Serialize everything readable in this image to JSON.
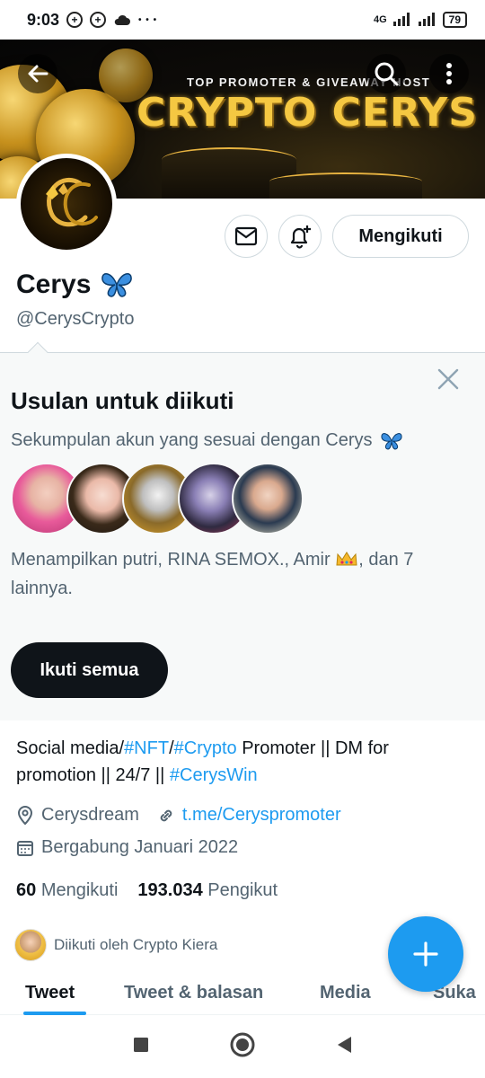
{
  "status_bar": {
    "time": "9:03",
    "dots": "• • •",
    "network": "4G",
    "battery": "79"
  },
  "banner": {
    "subtitle": "TOP PROMOTER & GIVEAWAY HOST",
    "title": "CRYPTO CERYS"
  },
  "profile": {
    "name": "Cerys",
    "name_emoji": "butterfly",
    "handle": "@CerysCrypto",
    "follow_label": "Mengikuti"
  },
  "suggestions": {
    "title": "Usulan untuk diikuti",
    "subtitle": "Sekumpulan akun yang sesuai dengan Cerys",
    "shown_text_prefix": "Menampilkan putri, RINA SEMOX., Amir",
    "shown_text_suffix": ", dan 7 lainnya.",
    "follow_all_label": "Ikuti semua"
  },
  "bio": {
    "parts": [
      {
        "text": "Social media/",
        "link": false
      },
      {
        "text": "#NFT",
        "link": true
      },
      {
        "text": "/",
        "link": false
      },
      {
        "text": "#Crypto",
        "link": true
      },
      {
        "text": " Promoter || DM for promotion || 24/7 || ",
        "link": false
      },
      {
        "text": "#CerysWin",
        "link": true
      }
    ]
  },
  "meta": {
    "location": "Cerysdream",
    "website": "t.me/Ceryspromoter",
    "joined": "Bergabung Januari 2022"
  },
  "counts": {
    "following_num": "60",
    "following_label": "Mengikuti",
    "followers_num": "193.034",
    "followers_label": "Pengikut"
  },
  "followed_by": "Diikuti oleh Crypto Kiera",
  "tabs": [
    "Tweet",
    "Tweet & balasan",
    "Media",
    "Suka"
  ],
  "colors": {
    "accent": "#1d9bf0",
    "text": "#0f1419",
    "muted": "#536471",
    "gold": "#f5c842"
  }
}
